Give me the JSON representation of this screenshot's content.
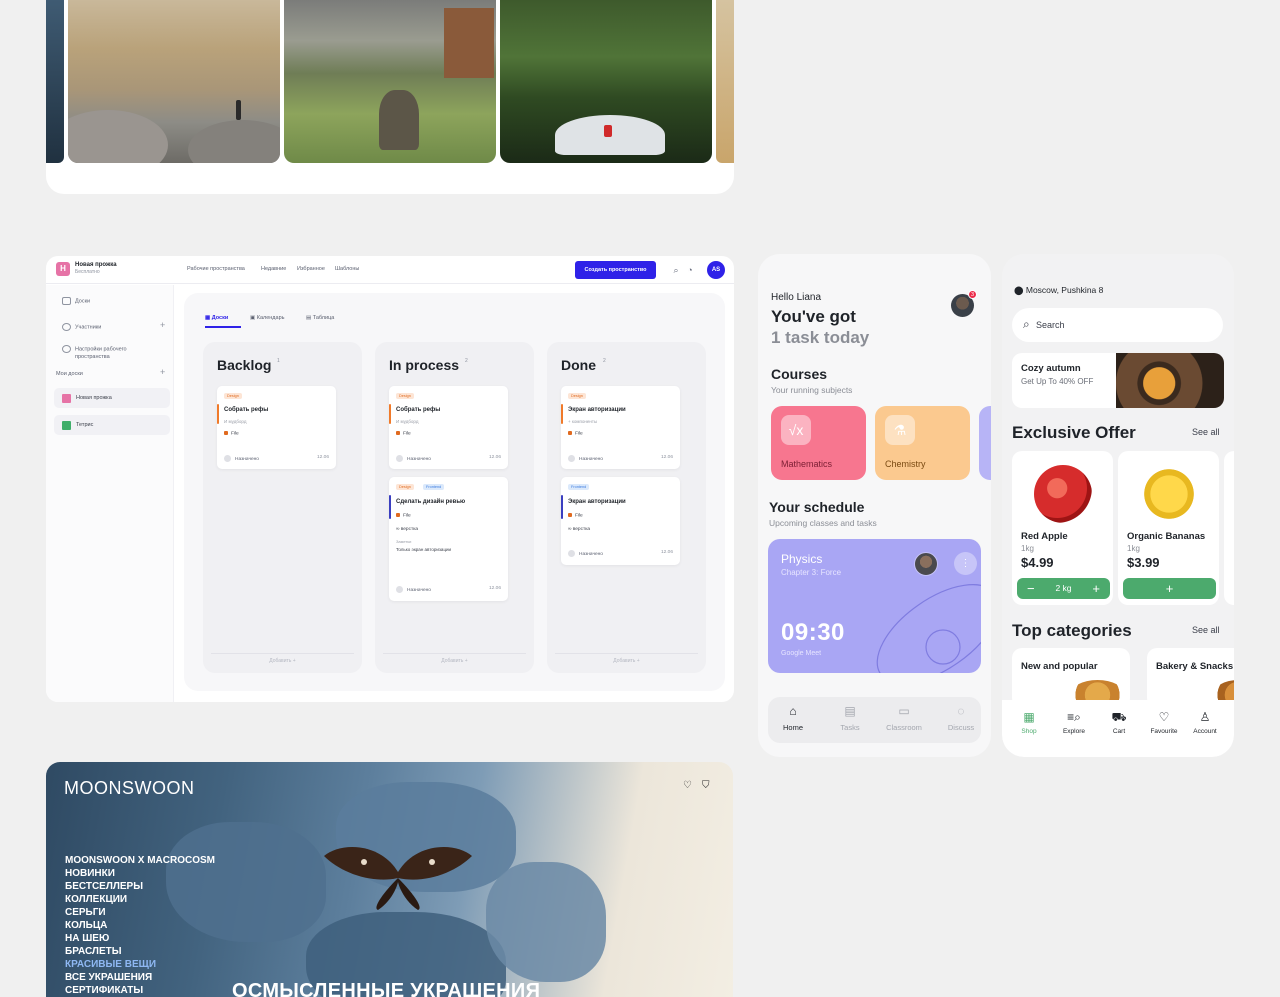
{
  "board": {
    "workspace": {
      "initial": "H",
      "name": "Новая прожка",
      "plan": "Бесплатно"
    },
    "nav": [
      "Рабочие пространства",
      "Недавние",
      "Избранное",
      "Шаблоны"
    ],
    "create_button": "Создать пространство",
    "user_initials": "AS",
    "sidebar": {
      "items": [
        "Доски",
        "Участники",
        "Настройки рабочего",
        "пространства"
      ],
      "boards_label": "Мои доски",
      "boards": [
        "Новая прожка",
        "Тетрис"
      ]
    },
    "tabs": [
      "Доски",
      "Календарь",
      "Таблица"
    ],
    "add_label": "Добавить",
    "columns": [
      {
        "title": "Backlog",
        "count": "1"
      },
      {
        "title": "In process",
        "count": "2"
      },
      {
        "title": "Done",
        "count": "2"
      }
    ],
    "cards": [
      {
        "tag": "Design",
        "title": "Собрать рефы",
        "sub": "И мудборд",
        "file": "File",
        "assignee": "Назначено",
        "date": "12.06"
      },
      {
        "tag": "Design",
        "title": "Собрать рефы",
        "sub": "И мудборд",
        "file": "File",
        "assignee": "Назначено",
        "date": "12.06"
      },
      {
        "tag": "Design",
        "tag2": "Frontend",
        "title": "Сделать дизайн ревью",
        "file": "File",
        "link": "верстка",
        "note_label": "Заметки",
        "note": "Только экран авторизации",
        "assignee": "Назначено",
        "date": "12.06"
      },
      {
        "tag": "Design",
        "title": "Экран авторизации",
        "sub": "+ компоненты",
        "file": "File",
        "assignee": "Назначено",
        "date": "12.06"
      },
      {
        "tag": "Frontend",
        "title": "Экран авторизации",
        "file": "File",
        "link": "верстка",
        "assignee": "Назначено",
        "date": "12.06"
      }
    ]
  },
  "study": {
    "greeting": "Hello Liana",
    "headline1": "You've got",
    "headline2": "1 task today",
    "notif_count": "3",
    "courses_title": "Courses",
    "courses_sub": "Your running subjects",
    "courses": [
      {
        "name": "Mathematics",
        "icon": "sqrt-icon",
        "color": "#f7768f"
      },
      {
        "name": "Chemistry",
        "icon": "flask-icon",
        "color": "#fbc98f"
      }
    ],
    "schedule_title": "Your schedule",
    "schedule_sub": "Upcoming classes and tasks",
    "schedule": {
      "subject": "Physics",
      "chapter": "Chapter 3: Force",
      "time": "09:30",
      "platform": "Google Meet"
    },
    "nav": [
      "Home",
      "Tasks",
      "Classroom",
      "Discuss"
    ]
  },
  "grocery": {
    "location": "Moscow, Pushkina 8",
    "search_placeholder": "Search",
    "promo": {
      "title": "Cozy autumn",
      "subtitle": "Get Up To 40% OFF"
    },
    "offer_title": "Exclusive Offer",
    "see_all": "See all",
    "products": [
      {
        "name": "Red Apple",
        "unit": "1kg",
        "price": "$4.99",
        "qty": "2 kg"
      },
      {
        "name": "Organic Bananas",
        "unit": "1kg",
        "price": "$3.99"
      }
    ],
    "categories_title": "Top categories",
    "categories": [
      "New and popular",
      "Bakery & Snacks"
    ],
    "nav": [
      "Shop",
      "Explore",
      "Cart",
      "Favourite",
      "Account"
    ]
  },
  "moon": {
    "logo": "MOONSWOON",
    "menu": [
      "MOONSWOON X MACROCOSM",
      "НОВИНКИ",
      "БЕСТСЕЛЛЕРЫ",
      "КОЛЛЕКЦИИ",
      "СЕРЬГИ",
      "КОЛЬЦА",
      "НА ШЕЮ",
      "БРАСЛЕТЫ",
      "КРАСИВЫЕ ВЕЩИ",
      "ВСЕ УКРАШЕНИЯ",
      "СЕРТИФИКАТЫ"
    ],
    "hero": "ОСМЫСЛЕННЫЕ УКРАШЕНИЯ"
  },
  "colors": {
    "board_accent": "#2f22e8",
    "grocery_green": "#4caa6d",
    "schedule_card": "#a9a6f4"
  }
}
